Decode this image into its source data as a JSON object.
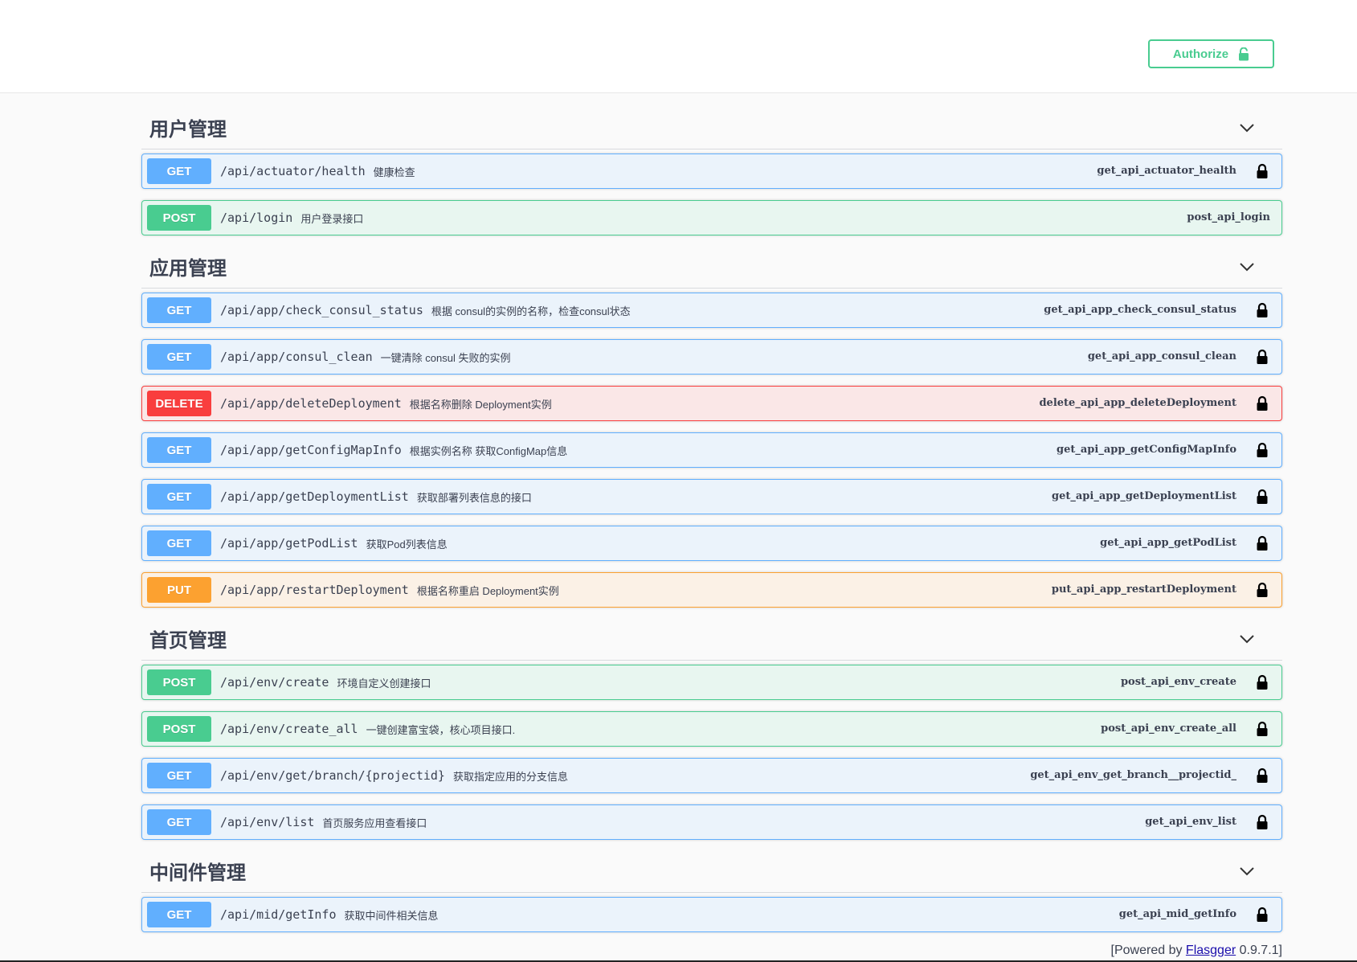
{
  "header": {
    "authorize_label": "Authorize"
  },
  "sections": [
    {
      "title": "用户管理",
      "operations": [
        {
          "method": "GET",
          "path": "/api/actuator/health",
          "summary": "健康检查",
          "operation_id": "get_api_actuator_health",
          "locked": true
        },
        {
          "method": "POST",
          "path": "/api/login",
          "summary": "用户登录接口",
          "operation_id": "post_api_login",
          "locked": false
        }
      ]
    },
    {
      "title": "应用管理",
      "operations": [
        {
          "method": "GET",
          "path": "/api/app/check_consul_status",
          "summary": "根据 consul的实例的名称，检查consul状态",
          "operation_id": "get_api_app_check_consul_status",
          "locked": true
        },
        {
          "method": "GET",
          "path": "/api/app/consul_clean",
          "summary": "一键清除 consul 失败的实例",
          "operation_id": "get_api_app_consul_clean",
          "locked": true
        },
        {
          "method": "DELETE",
          "path": "/api/app/deleteDeployment",
          "summary": "根据名称删除 Deployment实例",
          "operation_id": "delete_api_app_deleteDeployment",
          "locked": true
        },
        {
          "method": "GET",
          "path": "/api/app/getConfigMapInfo",
          "summary": "根据实例名称 获取ConfigMap信息",
          "operation_id": "get_api_app_getConfigMapInfo",
          "locked": true
        },
        {
          "method": "GET",
          "path": "/api/app/getDeploymentList",
          "summary": "获取部署列表信息的接口",
          "operation_id": "get_api_app_getDeploymentList",
          "locked": true
        },
        {
          "method": "GET",
          "path": "/api/app/getPodList",
          "summary": "获取Pod列表信息",
          "operation_id": "get_api_app_getPodList",
          "locked": true
        },
        {
          "method": "PUT",
          "path": "/api/app/restartDeployment",
          "summary": "根据名称重启 Deployment实例",
          "operation_id": "put_api_app_restartDeployment",
          "locked": true
        }
      ]
    },
    {
      "title": "首页管理",
      "operations": [
        {
          "method": "POST",
          "path": "/api/env/create",
          "summary": "环境自定义创建接口",
          "operation_id": "post_api_env_create",
          "locked": true
        },
        {
          "method": "POST",
          "path": "/api/env/create_all",
          "summary": "一键创建富宝袋，核心项目接口.",
          "operation_id": "post_api_env_create_all",
          "locked": true
        },
        {
          "method": "GET",
          "path": "/api/env/get/branch/{projectid}",
          "summary": "获取指定应用的分支信息",
          "operation_id": "get_api_env_get_branch__projectid_",
          "locked": true
        },
        {
          "method": "GET",
          "path": "/api/env/list",
          "summary": "首页服务应用查看接口",
          "operation_id": "get_api_env_list",
          "locked": true
        }
      ]
    },
    {
      "title": "中间件管理",
      "operations": [
        {
          "method": "GET",
          "path": "/api/mid/getInfo",
          "summary": "获取中间件相关信息",
          "operation_id": "get_api_mid_getInfo",
          "locked": true
        }
      ]
    }
  ],
  "footer": {
    "prefix": "[Powered by ",
    "link": "Flasgger",
    "suffix": " 0.9.7.1]"
  }
}
